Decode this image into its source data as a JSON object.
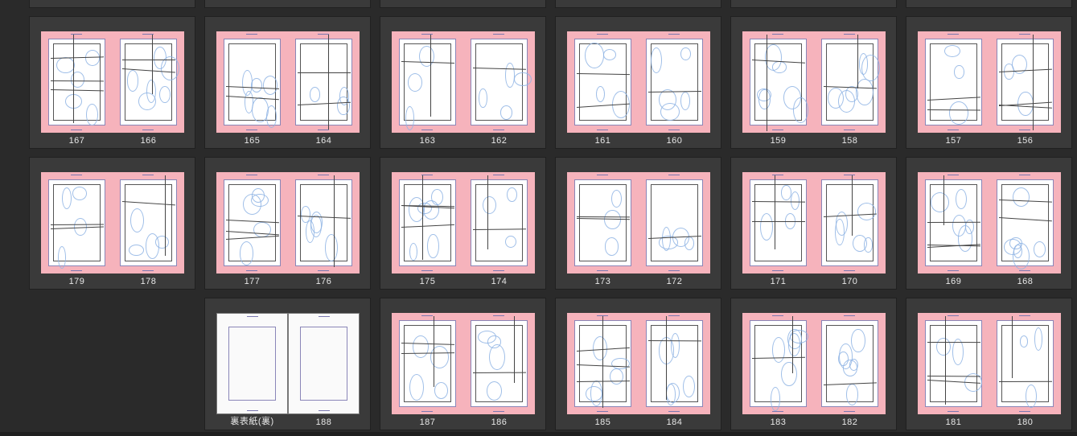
{
  "spreads": [
    {
      "row": 0,
      "col": 0,
      "pages": [
        {
          "label": "167"
        },
        {
          "label": "166"
        }
      ]
    },
    {
      "row": 0,
      "col": 1,
      "pages": [
        {
          "label": "165"
        },
        {
          "label": "164"
        }
      ]
    },
    {
      "row": 0,
      "col": 2,
      "pages": [
        {
          "label": "163"
        },
        {
          "label": "162"
        }
      ]
    },
    {
      "row": 0,
      "col": 3,
      "pages": [
        {
          "label": "161"
        },
        {
          "label": "160"
        }
      ]
    },
    {
      "row": 0,
      "col": 4,
      "pages": [
        {
          "label": "159"
        },
        {
          "label": "158"
        }
      ]
    },
    {
      "row": 0,
      "col": 5,
      "pages": [
        {
          "label": "157"
        },
        {
          "label": "156"
        }
      ]
    },
    {
      "row": 1,
      "col": 0,
      "pages": [
        {
          "label": "179"
        },
        {
          "label": "178"
        }
      ]
    },
    {
      "row": 1,
      "col": 1,
      "pages": [
        {
          "label": "177"
        },
        {
          "label": "176"
        }
      ]
    },
    {
      "row": 1,
      "col": 2,
      "pages": [
        {
          "label": "175"
        },
        {
          "label": "174"
        }
      ]
    },
    {
      "row": 1,
      "col": 3,
      "pages": [
        {
          "label": "173"
        },
        {
          "label": "172"
        }
      ]
    },
    {
      "row": 1,
      "col": 4,
      "pages": [
        {
          "label": "171"
        },
        {
          "label": "170"
        }
      ]
    },
    {
      "row": 1,
      "col": 5,
      "pages": [
        {
          "label": "169"
        },
        {
          "label": "168"
        }
      ]
    },
    {
      "row": 2,
      "col": 1,
      "pages": [
        {
          "label": "裏表紙(裏)",
          "white": true
        },
        {
          "label": "188",
          "white": true
        }
      ]
    },
    {
      "row": 2,
      "col": 2,
      "pages": [
        {
          "label": "187"
        },
        {
          "label": "186"
        }
      ]
    },
    {
      "row": 2,
      "col": 3,
      "pages": [
        {
          "label": "185"
        },
        {
          "label": "184"
        }
      ]
    },
    {
      "row": 2,
      "col": 4,
      "pages": [
        {
          "label": "183"
        },
        {
          "label": "182"
        }
      ]
    },
    {
      "row": 2,
      "col": 5,
      "pages": [
        {
          "label": "181"
        },
        {
          "label": "180"
        }
      ]
    }
  ],
  "colors": {
    "background": "#2a2a2a",
    "spread": "#3a3a3a",
    "bleed": "#f6b3bc",
    "sketch": "#8fb4e4"
  }
}
